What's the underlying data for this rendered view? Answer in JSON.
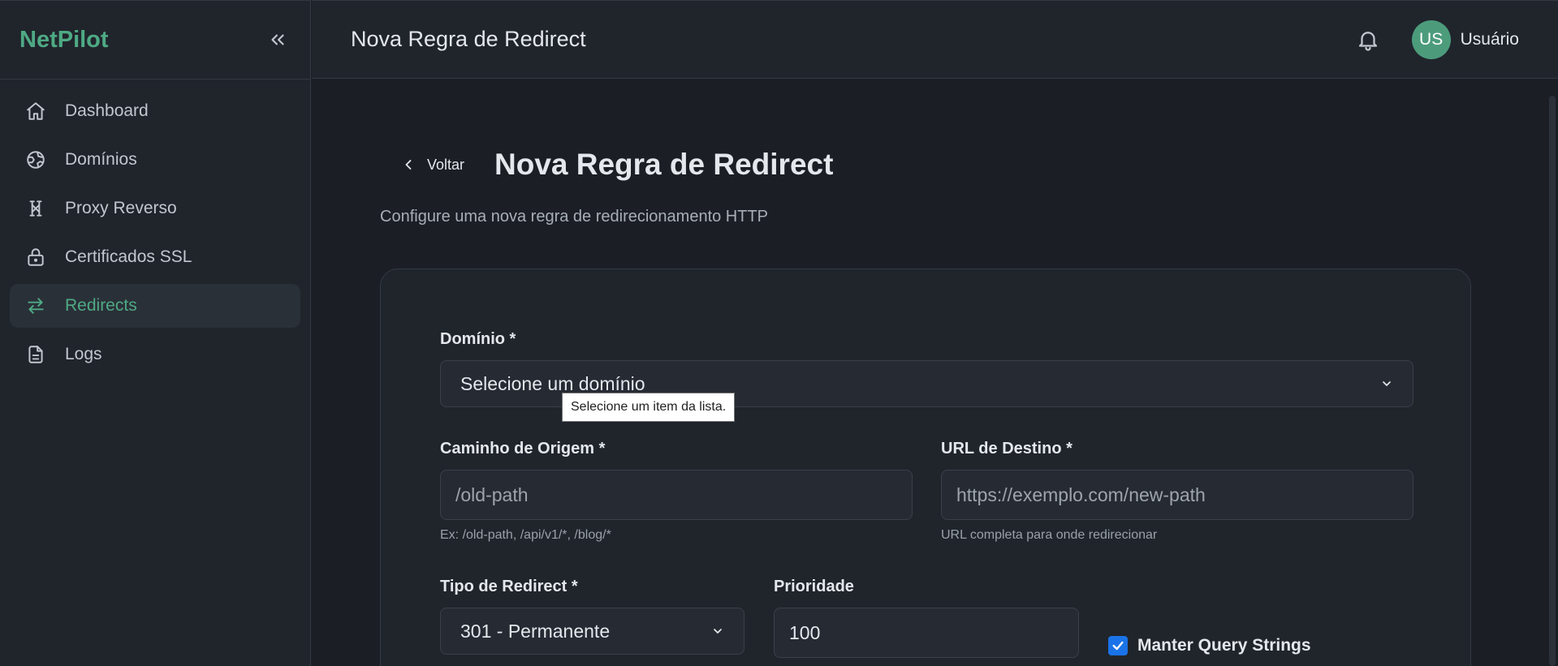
{
  "app": {
    "logo": "NetPilot"
  },
  "sidebar": {
    "items": [
      {
        "label": "Dashboard",
        "icon": "home-icon",
        "active": false
      },
      {
        "label": "Domínios",
        "icon": "globe-icon",
        "active": false
      },
      {
        "label": "Proxy Reverso",
        "icon": "proxy-icon",
        "active": false
      },
      {
        "label": "Certificados SSL",
        "icon": "lock-icon",
        "active": false
      },
      {
        "label": "Redirects",
        "icon": "arrows-icon",
        "active": true
      },
      {
        "label": "Logs",
        "icon": "file-icon",
        "active": false
      }
    ]
  },
  "topbar": {
    "title": "Nova Regra de Redirect",
    "avatar_initials": "US",
    "username": "Usuário"
  },
  "page": {
    "back_label": "Voltar",
    "title": "Nova Regra de Redirect",
    "subtitle": "Configure uma nova regra de redirecionamento HTTP"
  },
  "form": {
    "domain": {
      "label": "Domínio *",
      "selected": "Selecione um domínio",
      "tooltip": "Selecione um item da lista."
    },
    "source_path": {
      "label": "Caminho de Origem *",
      "placeholder": "/old-path",
      "helper": "Ex: /old-path, /api/v1/*, /blog/*"
    },
    "target_url": {
      "label": "URL de Destino *",
      "placeholder": "https://exemplo.com/new-path",
      "helper": "URL completa para onde redirecionar"
    },
    "redirect_type": {
      "label": "Tipo de Redirect *",
      "selected": "301 - Permanente"
    },
    "priority": {
      "label": "Prioridade",
      "value": "100"
    },
    "keep_query": {
      "label": "Manter Query Strings",
      "checked": true
    }
  },
  "colors": {
    "accent": "#4eaa84",
    "background": "#1b1f25",
    "panel": "#20252c",
    "checkbox": "#1a73e8"
  }
}
